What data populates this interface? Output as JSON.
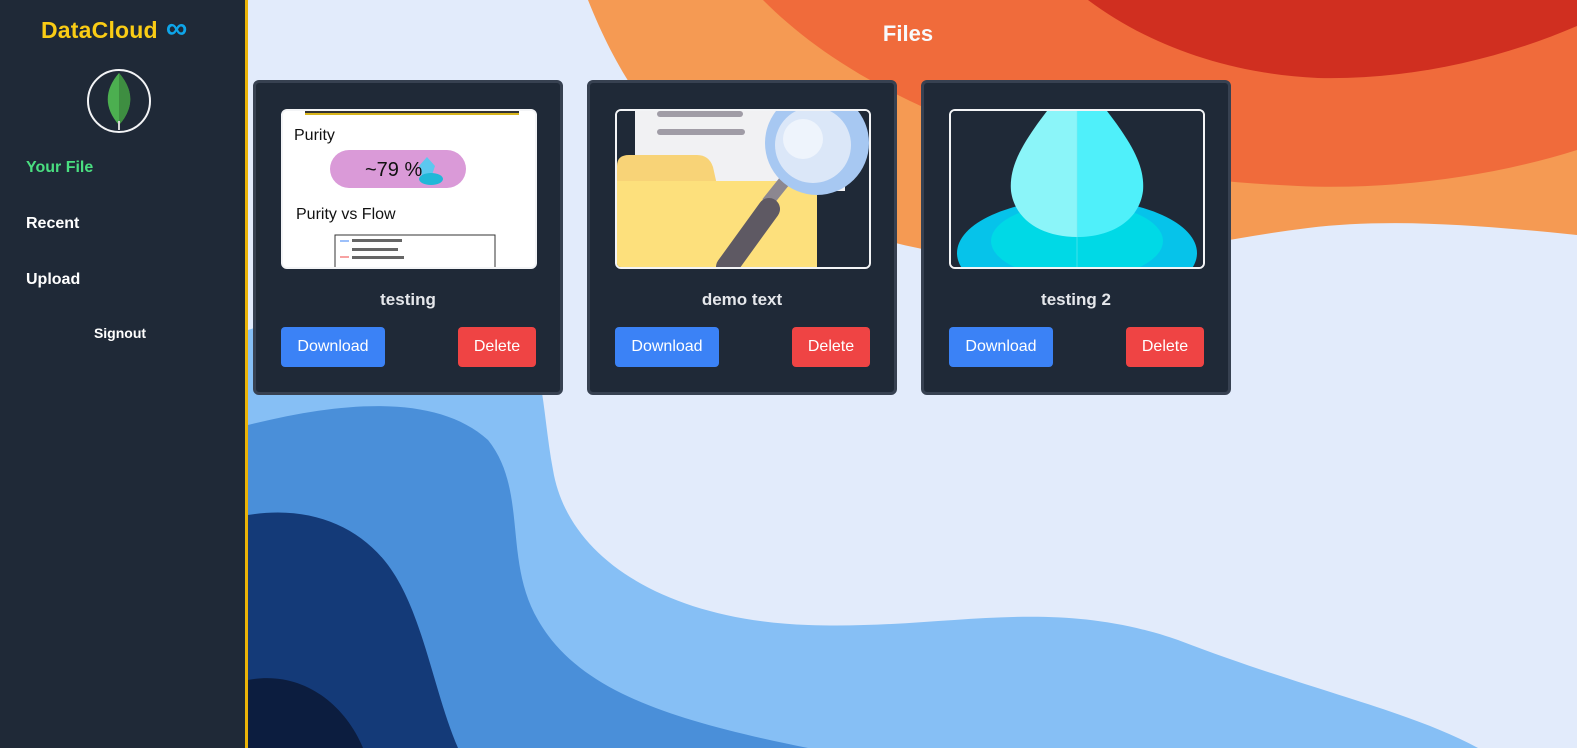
{
  "app": {
    "brand": "DataCloud",
    "brand_icon": "∞",
    "accent_color": "#facc15"
  },
  "sidebar": {
    "items": [
      {
        "label": "Your File",
        "active": true
      },
      {
        "label": "Recent",
        "active": false
      },
      {
        "label": "Upload",
        "active": false
      }
    ],
    "signout": "Signout"
  },
  "main": {
    "title": "Files",
    "files": [
      {
        "name": "testing",
        "thumb": {
          "heading1": "Purity",
          "pill": "~79 %",
          "heading2": "Purity vs Flow"
        },
        "download": "Download",
        "delete": "Delete"
      },
      {
        "name": "demo text",
        "download": "Download",
        "delete": "Delete"
      },
      {
        "name": "testing 2",
        "download": "Download",
        "delete": "Delete"
      }
    ]
  }
}
